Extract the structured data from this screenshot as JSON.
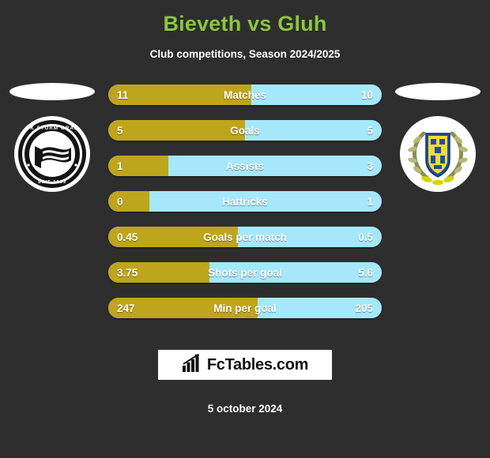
{
  "header": {
    "title": "Bieveth vs Gluh",
    "subtitle": "Club competitions, Season 2024/2025",
    "title_color": "#8dc63f"
  },
  "teams": {
    "home": {
      "crest_name": "sk-sturm-graz-crest",
      "crest_text_top": "SK STURM GRAZ",
      "crest_text_bottom": "SEIT 1909"
    },
    "away": {
      "crest_name": "gluh-crest"
    }
  },
  "colors": {
    "home_bar": "#bfa51b",
    "away_bar": "#a5e8fb",
    "background": "#2e2e2e",
    "text": "#ffffff"
  },
  "chart_data": {
    "type": "bar",
    "title": "Bieveth vs Gluh",
    "subtitle": "Club competitions, Season 2024/2025",
    "orientation": "horizontal-diverging",
    "legend_position": "none",
    "grid": false,
    "categories": [
      "Matches",
      "Goals",
      "Assists",
      "Hattricks",
      "Goals per match",
      "Shots per goal",
      "Min per goal"
    ],
    "series": [
      {
        "name": "Bieveth",
        "color": "#bfa51b",
        "values": [
          11,
          5,
          1,
          0,
          0.45,
          3.75,
          247
        ]
      },
      {
        "name": "Gluh",
        "color": "#a5e8fb",
        "values": [
          10,
          5,
          3,
          1,
          0.5,
          5.6,
          205
        ]
      }
    ],
    "rows": [
      {
        "label": "Matches",
        "home": "11",
        "away": "10",
        "home_pct": 52.4
      },
      {
        "label": "Goals",
        "home": "5",
        "away": "5",
        "home_pct": 50.0
      },
      {
        "label": "Assists",
        "home": "1",
        "away": "3",
        "home_pct": 22.0
      },
      {
        "label": "Hattricks",
        "home": "0",
        "away": "1",
        "home_pct": 15.0
      },
      {
        "label": "Goals per match",
        "home": "0.45",
        "away": "0.5",
        "home_pct": 47.4
      },
      {
        "label": "Shots per goal",
        "home": "3.75",
        "away": "5.6",
        "home_pct": 37.0
      },
      {
        "label": "Min per goal",
        "home": "247",
        "away": "205",
        "home_pct": 54.6
      }
    ]
  },
  "footer": {
    "logo_text": "FcTables.com",
    "logo_icon": "bar-chart-arrow-icon",
    "date": "5 october 2024"
  }
}
